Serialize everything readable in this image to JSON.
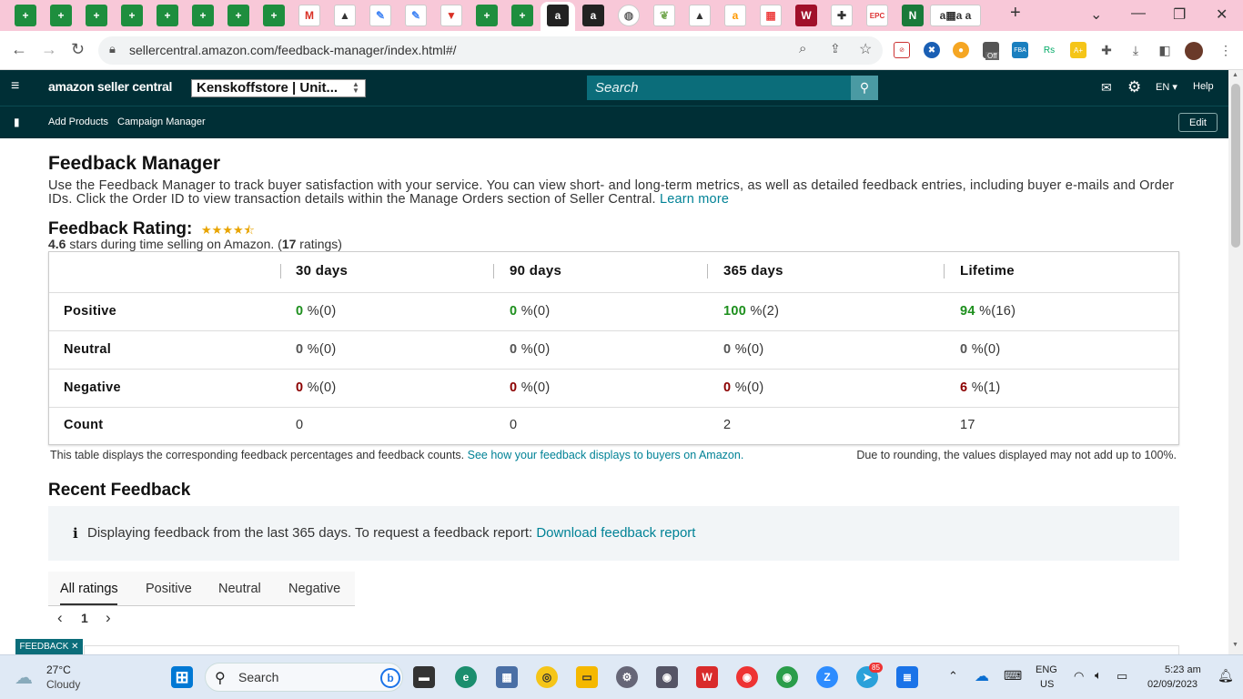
{
  "browser": {
    "url": "sellercentral.amazon.com/feedback-manager/index.html#/",
    "new_tab": "+",
    "window_controls": {
      "minimize": "—",
      "maximize": "❐",
      "close": "✕",
      "dropdown": "⌄"
    },
    "ext_badge": "Off"
  },
  "header": {
    "logo": "amazon seller central",
    "store": "Kenskoffstore | Unit...",
    "search_placeholder": "Search",
    "language": "EN",
    "help": "Help",
    "subnav": [
      "Add Products",
      "Campaign Manager"
    ],
    "edit": "Edit"
  },
  "page": {
    "title": "Feedback Manager",
    "intro": "Use the Feedback Manager to track buyer satisfaction with your service. You can view short- and long-term metrics, as well as detailed feedback entries, including buyer e-mails and Order IDs. Click the Order ID to view transaction details within the Manage Orders section of Seller Central.",
    "learn_more": "Learn more",
    "rating_title": "Feedback Rating:",
    "rating_value": "4.6",
    "rating_text": "stars during time selling on Amazon. (",
    "rating_count": "17",
    "rating_suffix": "ratings)",
    "table": {
      "columns": [
        "30 days",
        "90 days",
        "365 days",
        "Lifetime"
      ],
      "rows": [
        {
          "label": "Positive",
          "cells": [
            [
              "0",
              "%(0)"
            ],
            [
              "0",
              "%(0)"
            ],
            [
              "100",
              "%(2)"
            ],
            [
              "94",
              "%(16)"
            ]
          ]
        },
        {
          "label": "Neutral",
          "cells": [
            [
              "0",
              "%(0)"
            ],
            [
              "0",
              "%(0)"
            ],
            [
              "0",
              "%(0)"
            ],
            [
              "0",
              "%(0)"
            ]
          ]
        },
        {
          "label": "Negative",
          "cells": [
            [
              "0",
              "%(0)"
            ],
            [
              "0",
              "%(0)"
            ],
            [
              "0",
              "%(0)"
            ],
            [
              "6",
              "%(1)"
            ]
          ]
        },
        {
          "label": "Count",
          "cells": [
            [
              "0",
              ""
            ],
            [
              "0",
              ""
            ],
            [
              "2",
              ""
            ],
            [
              "17",
              ""
            ]
          ]
        }
      ]
    },
    "note": "This table displays the corresponding feedback percentages and feedback counts.",
    "note_link": "See how your feedback displays to buyers on Amazon.",
    "note_right": "Due to rounding, the values displayed may not add up to 100%.",
    "recent_title": "Recent Feedback",
    "info_icon": "i",
    "info_text": "Displaying feedback from the last 365 days. To request a feedback report:",
    "info_link": "Download feedback report",
    "tabs": [
      "All ratings",
      "Positive",
      "Neutral",
      "Negative"
    ],
    "pager": {
      "prev": "‹",
      "page": "1",
      "next": "›"
    },
    "feedback_button": "FEEDBACK ✕"
  },
  "taskbar": {
    "weather_temp": "27°C",
    "weather_desc": "Cloudy",
    "search": "Search",
    "lang_top": "ENG",
    "lang_bottom": "US",
    "time": "5:23 am",
    "date": "02/09/2023",
    "badge": "85"
  }
}
